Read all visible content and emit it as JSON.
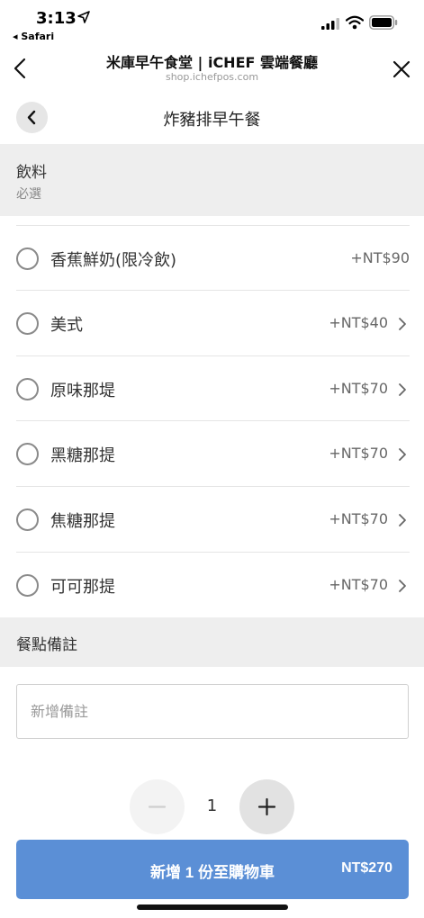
{
  "status_bar": {
    "time": "3:13",
    "back_app": "◂ Safari"
  },
  "browser": {
    "title": "米庫早午食堂 | iCHEF 雲端餐廳",
    "url": "shop.ichefpos.com"
  },
  "page": {
    "title": "炸豬排早午餐"
  },
  "drink_section": {
    "title": "飲料",
    "subtitle": "必選",
    "options": [
      {
        "name": "香蕉鮮奶(限冷飲)",
        "price": "+NT$90",
        "has_arrow": false
      },
      {
        "name": "美式",
        "price": "+NT$40",
        "has_arrow": true
      },
      {
        "name": "原味那堤",
        "price": "+NT$70",
        "has_arrow": true
      },
      {
        "name": "黑糖那提",
        "price": "+NT$70",
        "has_arrow": true
      },
      {
        "name": "焦糖那提",
        "price": "+NT$70",
        "has_arrow": true
      },
      {
        "name": "可可那提",
        "price": "+NT$70",
        "has_arrow": true
      }
    ]
  },
  "note_section": {
    "title": "餐點備註",
    "placeholder": "新增備註",
    "value": ""
  },
  "quantity": {
    "value": "1"
  },
  "cart_button": {
    "label": "新增 1 份至購物車",
    "price": "NT$270"
  },
  "colors": {
    "accent": "#5b8fd6",
    "section_bg": "#eeeeee"
  }
}
